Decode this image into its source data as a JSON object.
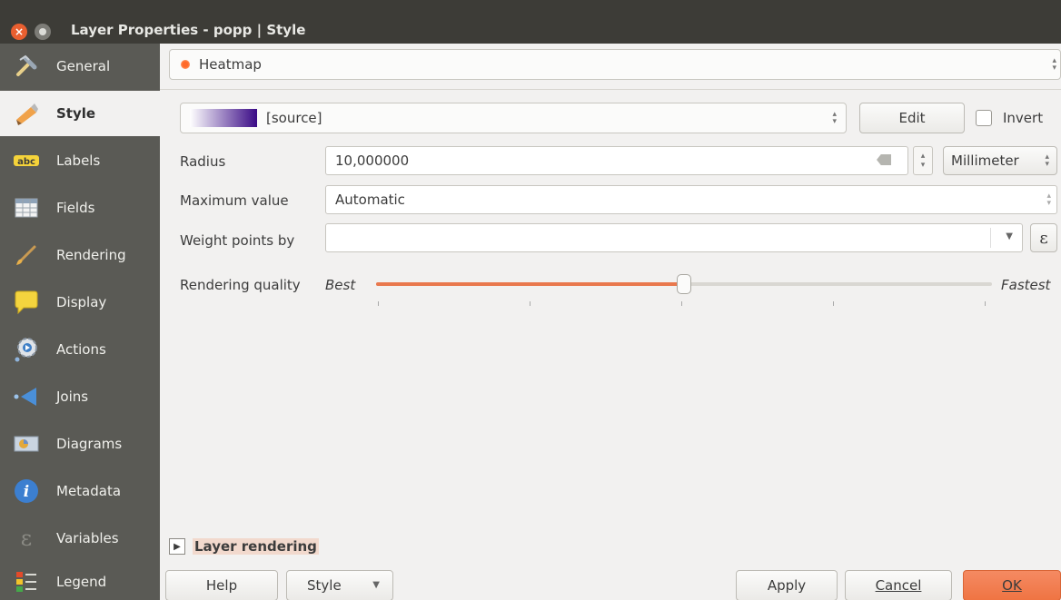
{
  "window": {
    "title": "Layer Properties - popp | Style"
  },
  "sidebar": {
    "items": [
      {
        "label": "General",
        "icon": "tools-icon"
      },
      {
        "label": "Style",
        "icon": "brush-icon",
        "active": true
      },
      {
        "label": "Labels",
        "icon": "abc-icon"
      },
      {
        "label": "Fields",
        "icon": "table-icon"
      },
      {
        "label": "Rendering",
        "icon": "paintbrush-icon"
      },
      {
        "label": "Display",
        "icon": "speech-bubble-icon"
      },
      {
        "label": "Actions",
        "icon": "gear-icon"
      },
      {
        "label": "Joins",
        "icon": "join-icon"
      },
      {
        "label": "Diagrams",
        "icon": "diagram-icon"
      },
      {
        "label": "Metadata",
        "icon": "info-icon"
      },
      {
        "label": "Variables",
        "icon": "epsilon-icon"
      },
      {
        "label": "Legend",
        "icon": "legend-icon"
      }
    ]
  },
  "renderer": {
    "selected": "Heatmap"
  },
  "color_ramp": {
    "name": "[source]",
    "edit_label": "Edit",
    "invert_label": "Invert",
    "invert_checked": false
  },
  "radius": {
    "label": "Radius",
    "value": "10,000000",
    "unit": "Millimeter"
  },
  "max_value": {
    "label": "Maximum value",
    "value": "Automatic"
  },
  "weight": {
    "label": "Weight points by",
    "value": "",
    "expression_symbol": "ε"
  },
  "quality": {
    "label": "Rendering quality",
    "left": "Best",
    "right": "Fastest",
    "level": 0.5
  },
  "layer_rendering": {
    "label": "Layer rendering"
  },
  "footer": {
    "help": "Help",
    "style": "Style",
    "apply": "Apply",
    "cancel": "Cancel",
    "ok": "OK"
  }
}
